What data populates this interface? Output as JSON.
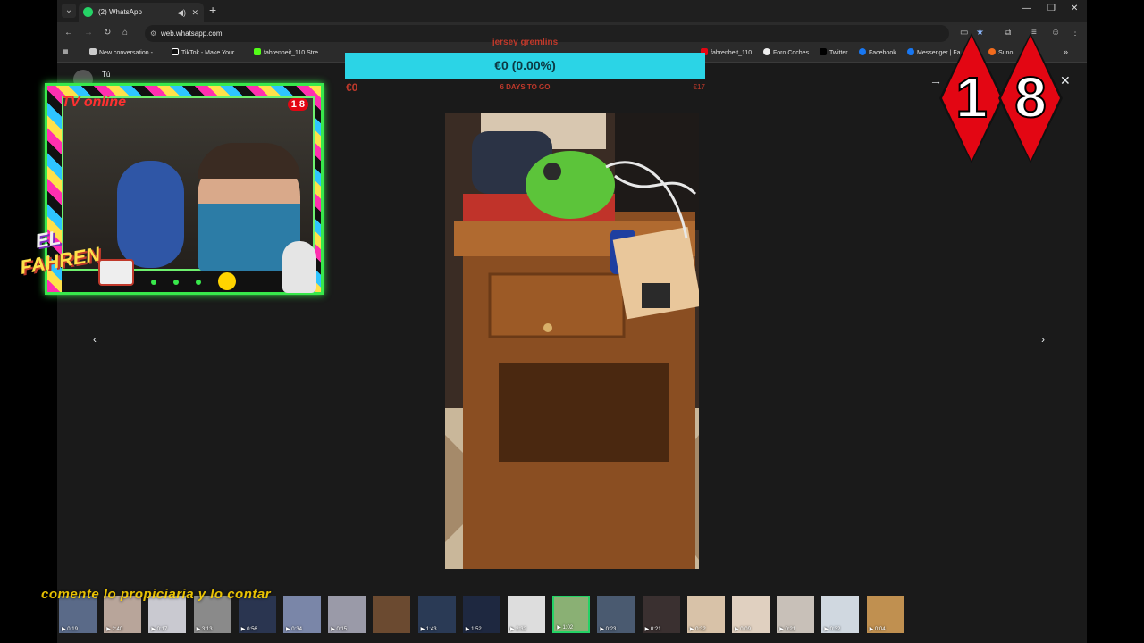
{
  "browser": {
    "tab_title": "(2) WhatsApp",
    "url": "web.whatsapp.com",
    "bookmarks": [
      {
        "label": "New conversation -..."
      },
      {
        "label": "TikTok - Make Your..."
      },
      {
        "label": "fahrenheit_110 Stre..."
      },
      {
        "label": "fahrenheit_110"
      },
      {
        "label": "Foro Coches"
      },
      {
        "label": "Twitter"
      },
      {
        "label": "Facebook"
      },
      {
        "label": "Messenger | Fa..."
      },
      {
        "label": "Suno"
      }
    ]
  },
  "viewer": {
    "sender_name": "Tú",
    "thumbnails": [
      {
        "duration": "0:19"
      },
      {
        "duration": "2:40"
      },
      {
        "duration": "0:17"
      },
      {
        "duration": "3:13"
      },
      {
        "duration": "0:56"
      },
      {
        "duration": "0:34"
      },
      {
        "duration": "0:15"
      },
      {
        "duration": ""
      },
      {
        "duration": "1:43"
      },
      {
        "duration": "1:52"
      },
      {
        "duration": "2:32"
      },
      {
        "duration": "1:02"
      },
      {
        "duration": "0:23"
      },
      {
        "duration": "0:21"
      },
      {
        "duration": "0:32"
      },
      {
        "duration": "0:09"
      },
      {
        "duration": "0:21"
      },
      {
        "duration": "0:32"
      },
      {
        "duration": "0:04"
      }
    ],
    "selected_index": 11
  },
  "donation": {
    "title": "jersey gremlins",
    "amount": "€0 (0.00%)",
    "current": "€0",
    "days_left": "6 DAYS TO GO",
    "goal": "€17"
  },
  "overlay": {
    "tv_label": "TV online",
    "badge": "1 8",
    "logo_line1": "EL",
    "logo_line2": "FAHREN",
    "age_digit1": "1",
    "age_digit2": "8",
    "ticker": "comente lo propiciaria y lo contar"
  },
  "colors": {
    "accent": "#25d366",
    "donation_bar": "#2bd4e6",
    "badge_red": "#e30613"
  }
}
